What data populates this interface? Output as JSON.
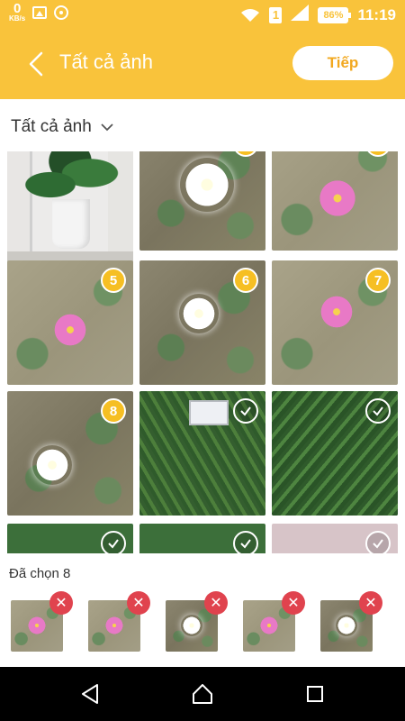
{
  "status_bar": {
    "net_speed_value": "0",
    "net_speed_unit": "KB/s",
    "sim_slot": "1",
    "battery_percent": "86%",
    "time": "11:19"
  },
  "header": {
    "title": "Tất cả ảnh",
    "next_label": "Tiếp",
    "background_color": "#f9c33b"
  },
  "album_selector": {
    "label": "Tất cả ảnh"
  },
  "grid": {
    "cells": [
      {
        "photo": "plant-pot",
        "badge": ""
      },
      {
        "photo": "white-water-lily",
        "badge": ""
      },
      {
        "photo": "pink-water-lily",
        "badge": ""
      },
      {
        "photo": "pink-water-lily",
        "badge": "5"
      },
      {
        "photo": "white-water-lily",
        "badge": "6"
      },
      {
        "photo": "pink-water-lily",
        "badge": "7"
      },
      {
        "photo": "white-water-lily",
        "badge": "8"
      },
      {
        "photo": "fern-sign",
        "badge": "check"
      },
      {
        "photo": "fern",
        "badge": "check"
      },
      {
        "photo": "leafy-plant",
        "badge": "check"
      },
      {
        "photo": "leafy-plant",
        "badge": "check"
      },
      {
        "photo": "wall",
        "badge": "check"
      }
    ]
  },
  "selected": {
    "label": "Đã chọn 8",
    "count": 8,
    "remove_icon": "close-icon",
    "thumbs": [
      {
        "photo": "pink-water-lily"
      },
      {
        "photo": "pink-water-lily"
      },
      {
        "photo": "white-water-lily"
      },
      {
        "photo": "pink-water-lily"
      },
      {
        "photo": "white-water-lily"
      }
    ]
  },
  "nav_bar": {
    "back_icon": "triangle-back-icon",
    "home_icon": "home-icon",
    "recents_icon": "square-recents-icon"
  },
  "colors": {
    "accent": "#f9c33b",
    "badge": "#f6bf23",
    "remove": "#e0434e"
  }
}
